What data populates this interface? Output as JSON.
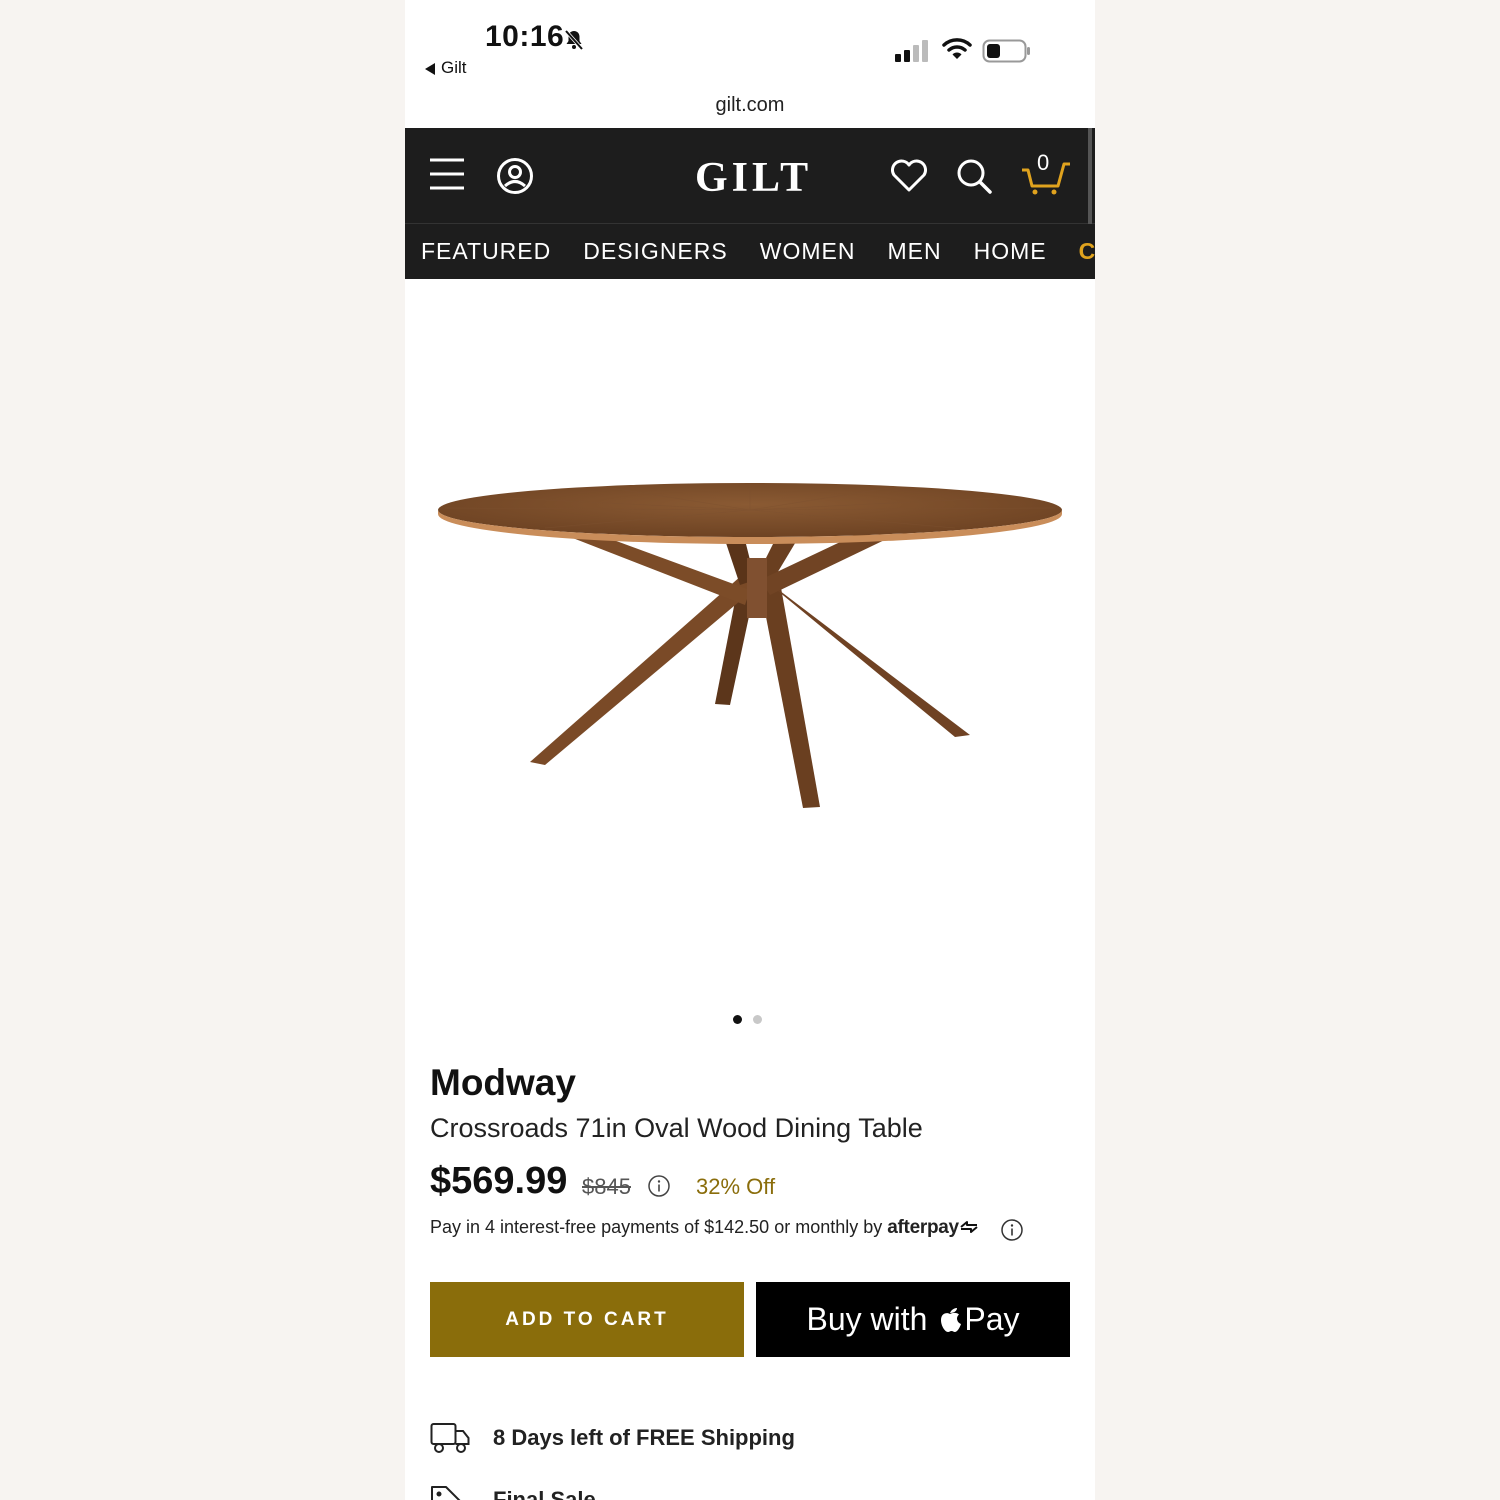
{
  "status_bar": {
    "time": "10:16",
    "back_label": "Gilt",
    "url": "gilt.com"
  },
  "header": {
    "logo": "GILT",
    "cart_count": "0",
    "nav": [
      {
        "label": "FEATURED"
      },
      {
        "label": "DESIGNERS"
      },
      {
        "label": "WOMEN"
      },
      {
        "label": "MEN"
      },
      {
        "label": "HOME"
      },
      {
        "label": "CLEA",
        "color": "#e0a31e"
      }
    ]
  },
  "gallery": {
    "active_index": 0,
    "total": 2,
    "image_alt": "wood-oval-dining-table"
  },
  "product": {
    "brand": "Modway",
    "title": "Crossroads 71in Oval Wood Dining Table",
    "price": "$569.99",
    "original_price": "$845",
    "discount": "32% Off",
    "afterpay_text": "Pay in 4 interest-free payments of $142.50 or monthly by",
    "afterpay_brand": "afterpay"
  },
  "actions": {
    "add_to_cart": "ADD TO CART",
    "apple_pay_prefix": "Buy with",
    "apple_pay_suffix": "Pay"
  },
  "info": {
    "shipping": "8 Days left of FREE Shipping",
    "final_sale": "Final Sale"
  },
  "colors": {
    "header_bg": "#1d1d1d",
    "accent_gold": "#8a6d0b",
    "nav_highlight": "#e0a31e"
  }
}
